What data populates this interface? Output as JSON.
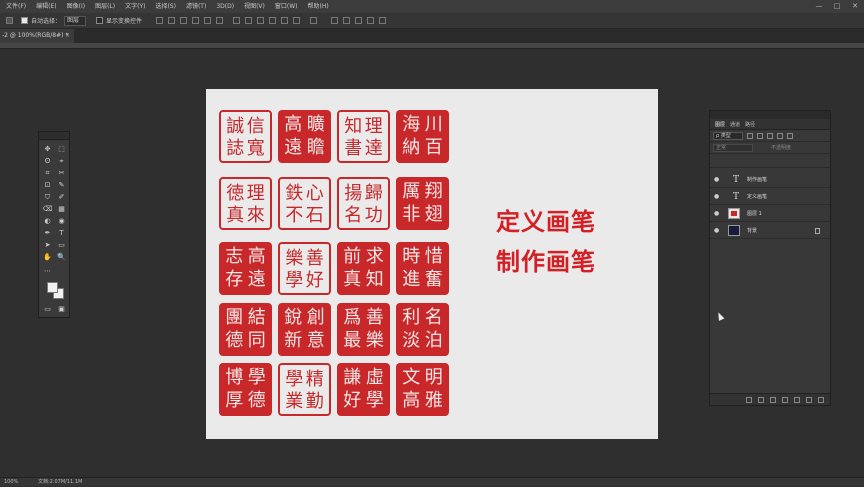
{
  "menubar": {
    "items": [
      "文件(F)",
      "编辑(E)",
      "图像(I)",
      "图层(L)",
      "文字(Y)",
      "选择(S)",
      "滤镜(T)",
      "3D(D)",
      "视图(V)",
      "窗口(W)",
      "帮助(H)"
    ],
    "window_controls": [
      "—",
      "□",
      "✕"
    ]
  },
  "options": {
    "auto_select_label": "自动选择：",
    "auto_select_value": "图层",
    "transform_label": "显示变换控件"
  },
  "tab": {
    "title": "-2 @ 100%(RGB/8#) *",
    "close": "×"
  },
  "tools": [
    "✥",
    "⬚",
    "ʘ",
    "⌖",
    "⌗",
    "✂",
    "⊡",
    "✎",
    "⛉",
    "✐",
    "⌫",
    "▦",
    "◐",
    "◉",
    "✒",
    "T",
    "➤",
    "▭",
    "✋",
    "🔍",
    "⋯"
  ],
  "seals": [
    {
      "chars": [
        "誠",
        "信",
        "誌",
        "寬"
      ],
      "style": "white"
    },
    {
      "chars": [
        "高",
        "曠",
        "遠",
        "瞻"
      ],
      "style": "red"
    },
    {
      "chars": [
        "知",
        "理",
        "書",
        "達"
      ],
      "style": "white"
    },
    {
      "chars": [
        "海",
        "川",
        "納",
        "百"
      ],
      "style": "red"
    },
    {
      "chars": [
        "徳",
        "理",
        "真",
        "來"
      ],
      "style": "white"
    },
    {
      "chars": [
        "鉄",
        "心",
        "不",
        "石"
      ],
      "style": "white"
    },
    {
      "chars": [
        "揚",
        "歸",
        "名",
        "功"
      ],
      "style": "white"
    },
    {
      "chars": [
        "厲",
        "翔",
        "非",
        "翅"
      ],
      "style": "red"
    },
    {
      "chars": [
        "志",
        "高",
        "存",
        "遠"
      ],
      "style": "red"
    },
    {
      "chars": [
        "樂",
        "善",
        "學",
        "好"
      ],
      "style": "white"
    },
    {
      "chars": [
        "前",
        "求",
        "真",
        "知"
      ],
      "style": "red"
    },
    {
      "chars": [
        "時",
        "惜",
        "進",
        "奮"
      ],
      "style": "red"
    },
    {
      "chars": [
        "團",
        "結",
        "德",
        "同"
      ],
      "style": "red"
    },
    {
      "chars": [
        "銳",
        "創",
        "新",
        "意"
      ],
      "style": "red"
    },
    {
      "chars": [
        "爲",
        "善",
        "最",
        "樂"
      ],
      "style": "red"
    },
    {
      "chars": [
        "利",
        "名",
        "淡",
        "泊"
      ],
      "style": "red"
    },
    {
      "chars": [
        "博",
        "學",
        "厚",
        "德"
      ],
      "style": "red"
    },
    {
      "chars": [
        "學",
        "精",
        "業",
        "勤"
      ],
      "style": "white"
    },
    {
      "chars": [
        "謙",
        "虛",
        "好",
        "學"
      ],
      "style": "red"
    },
    {
      "chars": [
        "文",
        "明",
        "高",
        "雅"
      ],
      "style": "red"
    }
  ],
  "heading": {
    "line1": "定义画笔",
    "line2": "制作画笔"
  },
  "layers_panel": {
    "tabs": [
      "图层",
      "通道",
      "路径"
    ],
    "filter_label": "ρ 类型",
    "mode_label": "正常",
    "opacity_label": "不透明度",
    "layers": [
      {
        "name": "制作画笔",
        "type": "text"
      },
      {
        "name": "定义画笔",
        "type": "text"
      },
      {
        "name": "图层 1",
        "type": "image"
      },
      {
        "name": "背景",
        "type": "background"
      }
    ]
  },
  "status": {
    "zoom": "100%",
    "doc": "文档:2.07M/11.1M"
  }
}
